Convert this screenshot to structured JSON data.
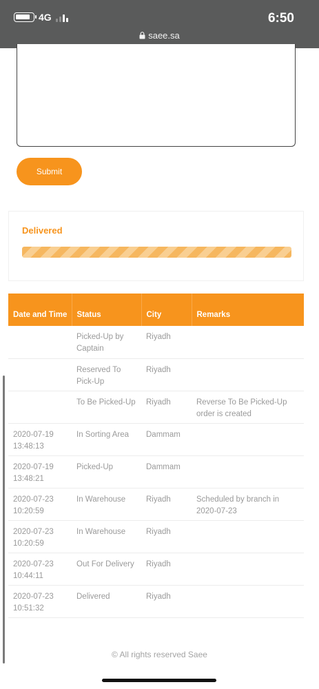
{
  "status_bar": {
    "network": "4G",
    "time": "6:50",
    "url": "saee.sa"
  },
  "form": {
    "submit_label": "Submit"
  },
  "shipment_status": {
    "label": "Delivered",
    "progress": 1.0
  },
  "table": {
    "headers": [
      "Date and Time",
      "Status",
      "City",
      "Remarks"
    ],
    "rows": [
      {
        "date": "",
        "status": "Picked-Up by Captain",
        "city": "Riyadh",
        "remarks": ""
      },
      {
        "date": "",
        "status": "Reserved To Pick-Up",
        "city": "Riyadh",
        "remarks": ""
      },
      {
        "date": "",
        "status": "To Be Picked-Up",
        "city": "Riyadh",
        "remarks": "Reverse To Be Picked-Up order is created"
      },
      {
        "date": "2020-07-19 13:48:13",
        "status": "In Sorting Area",
        "city": "Dammam",
        "remarks": ""
      },
      {
        "date": "2020-07-19 13:48:21",
        "status": "Picked-Up",
        "city": "Dammam",
        "remarks": ""
      },
      {
        "date": "2020-07-23 10:20:59",
        "status": "In Warehouse",
        "city": "Riyadh",
        "remarks": "Scheduled by branch in 2020-07-23"
      },
      {
        "date": "2020-07-23 10:20:59",
        "status": "In Warehouse",
        "city": "Riyadh",
        "remarks": ""
      },
      {
        "date": "2020-07-23 10:44:11",
        "status": "Out For Delivery",
        "city": "Riyadh",
        "remarks": ""
      },
      {
        "date": "2020-07-23 10:51:32",
        "status": "Delivered",
        "city": "Riyadh",
        "remarks": ""
      }
    ]
  },
  "footer": {
    "copyright": "© All rights reserved Saee"
  },
  "colors": {
    "accent": "#f7941d",
    "status_bar": "#5a5b5b",
    "muted_text": "#9a9a9a"
  }
}
